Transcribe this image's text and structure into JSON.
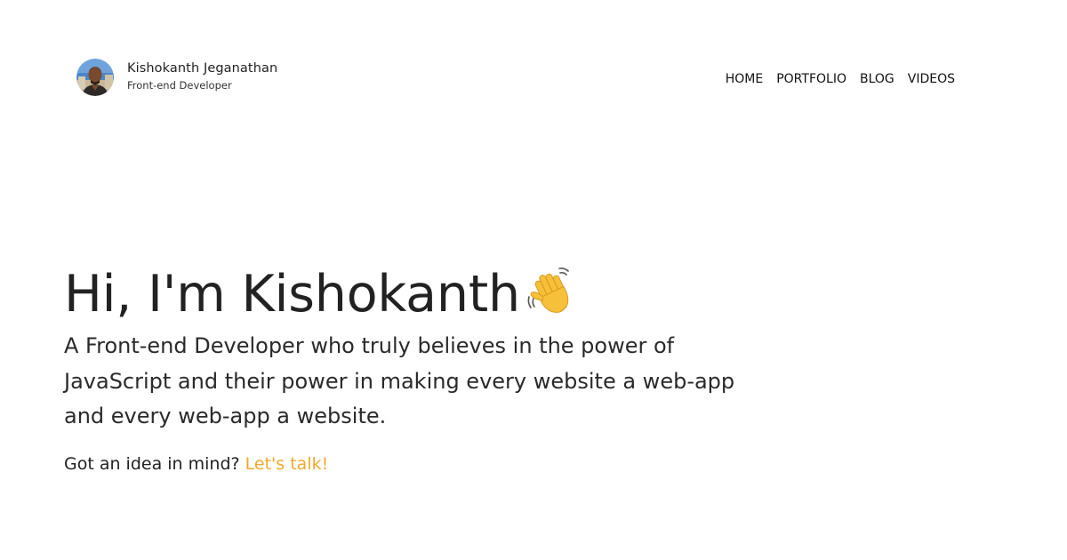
{
  "header": {
    "name": "Kishokanth Jeganathan",
    "role": "Front-end Developer",
    "avatar_icon": "profile-photo"
  },
  "nav": {
    "items": [
      {
        "label": "HOME"
      },
      {
        "label": "PORTFOLIO"
      },
      {
        "label": "BLOG"
      },
      {
        "label": "VIDEOS"
      }
    ]
  },
  "hero": {
    "title": "Hi, I'm Kishokanth",
    "wave_icon": "waving-hand",
    "description": "A Front-end Developer who truly believes in the power of JavaScript and their power in making every website a web-app and every web-app a website.",
    "cta_prefix": "Got an idea in mind?",
    "cta_link": "Let's talk!"
  },
  "colors": {
    "accent": "#f0a92b",
    "text": "#222222",
    "background": "#ffffff"
  }
}
